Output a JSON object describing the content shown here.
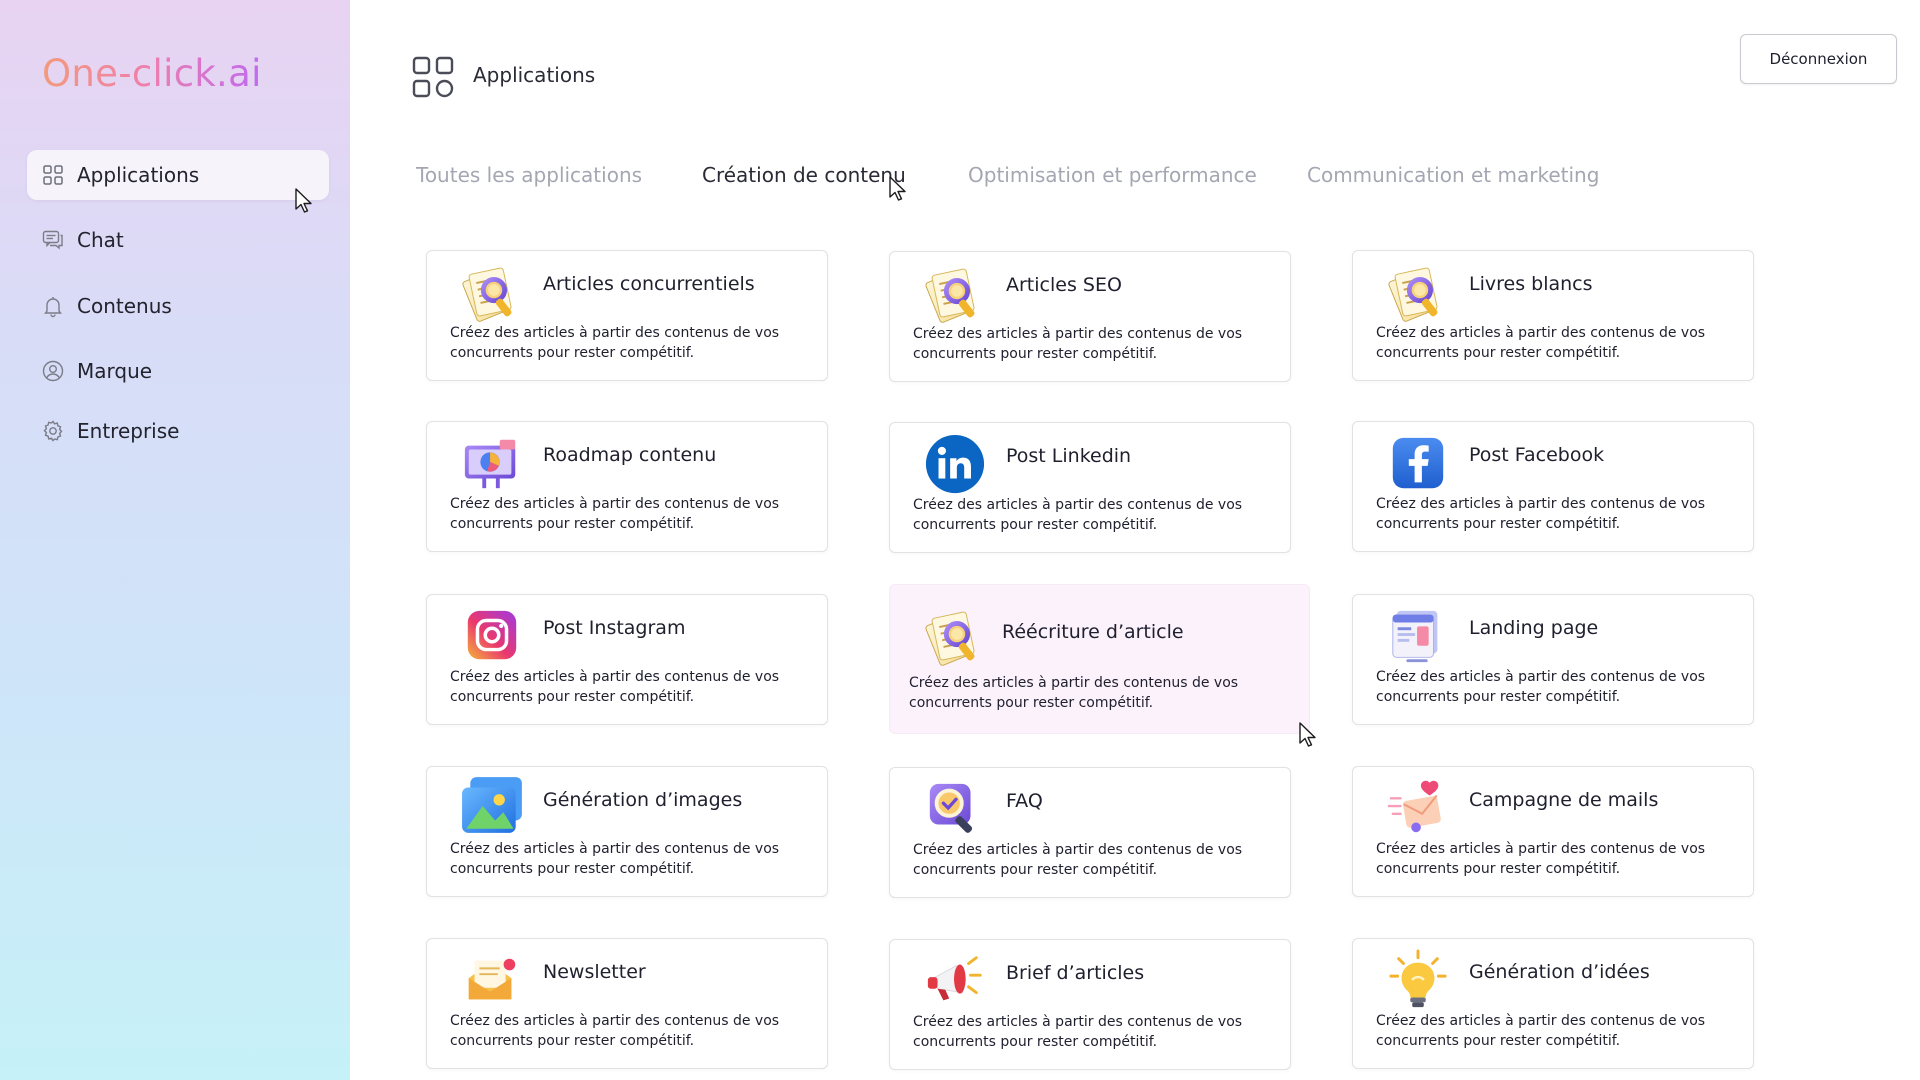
{
  "brand": {
    "logo_text": "One-click.ai"
  },
  "nav": {
    "items": [
      {
        "label": "Applications",
        "icon": "grid-icon",
        "active": true
      },
      {
        "label": "Chat",
        "icon": "chat-icon"
      },
      {
        "label": "Contenus",
        "icon": "bell-icon"
      },
      {
        "label": "Marque",
        "icon": "user-circle-icon"
      },
      {
        "label": "Entreprise",
        "icon": "gear-icon"
      }
    ]
  },
  "header": {
    "title": "Applications",
    "icon": "grid-icon",
    "logout_label": "Déconnexion"
  },
  "tabs": [
    {
      "label": "Toutes les applications",
      "active": false
    },
    {
      "label": "Création de contenu",
      "active": true
    },
    {
      "label": "Optimisation et performance",
      "active": false
    },
    {
      "label": "Communication et marketing",
      "active": false
    }
  ],
  "cards": [
    {
      "title": "Articles concurrentiels",
      "desc": "Créez des articles à partir des contenus de vos concurrents pour rester compétitif.",
      "icon": "papers-magnifier-icon"
    },
    {
      "title": "Articles SEO",
      "desc": "Créez des articles à partir des contenus de vos concurrents pour rester compétitif.",
      "icon": "papers-magnifier-icon"
    },
    {
      "title": "Livres blancs",
      "desc": "Créez des articles à partir des contenus de vos concurrents pour rester compétitif.",
      "icon": "papers-magnifier-icon"
    },
    {
      "title": "Roadmap contenu",
      "desc": "Créez des articles à partir des contenus de vos concurrents pour rester compétitif.",
      "icon": "presentation-chart-icon"
    },
    {
      "title": "Post Linkedin",
      "desc": "Créez des articles à partir des contenus de vos concurrents pour rester compétitif.",
      "icon": "linkedin-icon"
    },
    {
      "title": "Post Facebook",
      "desc": "Créez des articles à partir des contenus de vos concurrents pour rester compétitif.",
      "icon": "facebook-icon"
    },
    {
      "title": "Post Instagram",
      "desc": "Créez des articles à partir des contenus de vos concurrents pour rester compétitif.",
      "icon": "instagram-icon"
    },
    {
      "title": "Réécriture d’article",
      "desc": "Créez des articles à partir des contenus de vos concurrents pour rester compétitif.",
      "icon": "papers-magnifier-icon"
    },
    {
      "title": "Landing page",
      "desc": "Créez des articles à partir des contenus de vos concurrents pour rester compétitif.",
      "icon": "webpage-icon"
    },
    {
      "title": "Génération d’images",
      "desc": "Créez des articles à partir des contenus de vos concurrents pour rester compétitif.",
      "icon": "image-icon"
    },
    {
      "title": "FAQ",
      "desc": "Créez des articles à partir des contenus de vos concurrents pour rester compétitif.",
      "icon": "magnifier-check-icon"
    },
    {
      "title": "Campagne de mails",
      "desc": "Créez des articles à partir des contenus de vos concurrents pour rester compétitif.",
      "icon": "mail-heart-icon"
    },
    {
      "title": "Newsletter",
      "desc": "Créez des articles à partir des contenus de vos concurrents pour rester compétitif.",
      "icon": "envelope-notification-icon"
    },
    {
      "title": "Brief d’articles",
      "desc": "Créez des articles à partir des contenus de vos concurrents pour rester compétitif.",
      "icon": "megaphone-icon"
    },
    {
      "title": "Génération d’idées",
      "desc": "Créez des articles à partir des contenus de vos concurrents pour rester compétitif.",
      "icon": "lightbulb-icon"
    }
  ],
  "colors": {
    "brand_gradient_start": "#f29a7c",
    "brand_gradient_end": "#c06af0",
    "active_tab_text": "#2a2b36",
    "inactive_tab_text": "#a4a7b2",
    "card_highlight_bg": "#fbf2fc"
  }
}
